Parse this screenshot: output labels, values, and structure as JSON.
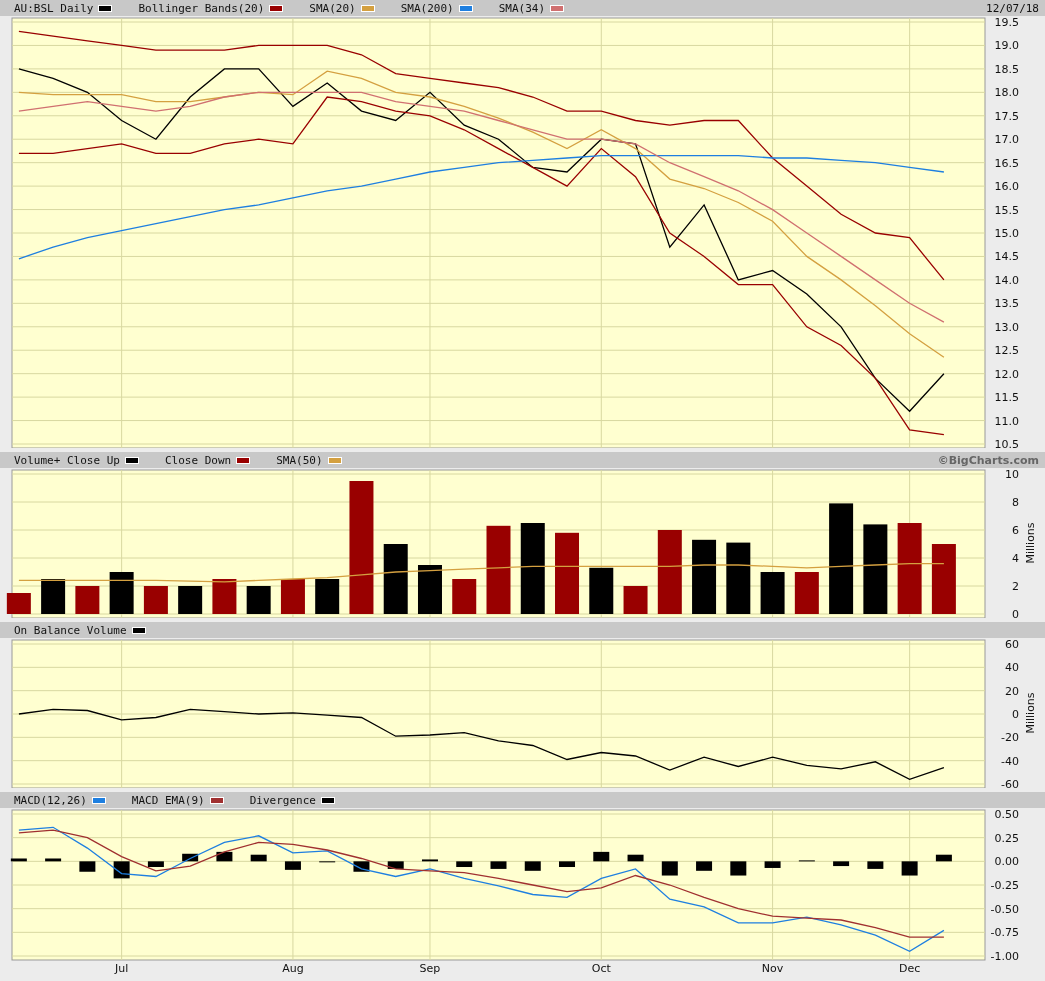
{
  "panels": [
    {
      "right_text": "12/07/18",
      "chart_data": {
        "type": "line",
        "grid": true,
        "categories": [
          null,
          null,
          null,
          null,
          null,
          null,
          null,
          null,
          null,
          null,
          null,
          null,
          null,
          null,
          null,
          null,
          null,
          null,
          null,
          null,
          null,
          null,
          null,
          null,
          null,
          null,
          null,
          null
        ],
        "ylim": [
          10.5,
          19.5
        ],
        "yticks": [
          {
            "value": 10.5,
            "label": "10.5"
          },
          {
            "value": 11,
            "label": "11.0"
          },
          {
            "value": 11.5,
            "label": "11.5"
          },
          {
            "value": 12,
            "label": "12.0"
          },
          {
            "value": 12.5,
            "label": "12.5"
          },
          {
            "value": 13,
            "label": "13.0"
          },
          {
            "value": 13.5,
            "label": "13.5"
          },
          {
            "value": 14,
            "label": "14.0"
          },
          {
            "value": 14.5,
            "label": "14.5"
          },
          {
            "value": 15,
            "label": "15.0"
          },
          {
            "value": 15.5,
            "label": "15.5"
          },
          {
            "value": 16,
            "label": "16.0"
          },
          {
            "value": 16.5,
            "label": "16.5"
          },
          {
            "value": 17,
            "label": "17.0"
          },
          {
            "value": 17.5,
            "label": "17.5"
          },
          {
            "value": 18,
            "label": "18.0"
          },
          {
            "value": 18.5,
            "label": "18.5"
          },
          {
            "value": 19,
            "label": "19.0"
          },
          {
            "value": 19.5,
            "label": "19.5"
          }
        ],
        "series": [
          {
            "name": "AU:BSL Daily",
            "color": "#000000",
            "values": [
              18.5,
              18.3,
              18.0,
              17.4,
              17.0,
              17.9,
              18.5,
              18.5,
              17.7,
              18.2,
              17.6,
              17.4,
              18.0,
              17.3,
              17.0,
              16.4,
              16.3,
              17.0,
              16.9,
              14.7,
              15.6,
              14.0,
              14.2,
              13.7,
              13.0,
              11.9,
              11.2,
              12.0
            ]
          },
          {
            "name": "Bollinger Bands(20)",
            "color": "#990000",
            "values": [
              19.3,
              19.2,
              19.1,
              19.0,
              18.9,
              18.9,
              18.9,
              19.0,
              19.0,
              19.0,
              18.8,
              18.4,
              18.3,
              18.2,
              18.1,
              17.9,
              17.6,
              17.6,
              17.4,
              17.3,
              17.4,
              17.4,
              16.6,
              16.0,
              15.4,
              15.0,
              14.9,
              14.0
            ]
          },
          {
            "color": "#990000",
            "values": [
              16.7,
              16.7,
              16.8,
              16.9,
              16.7,
              16.7,
              16.9,
              17.0,
              16.9,
              17.9,
              17.8,
              17.6,
              17.5,
              17.2,
              16.8,
              16.4,
              16.0,
              16.8,
              16.2,
              15.0,
              14.5,
              13.9,
              13.9,
              13.0,
              12.6,
              11.9,
              10.8,
              10.7
            ]
          },
          {
            "name": "SMA(20)",
            "color": "#d4a040",
            "values": [
              18.0,
              17.95,
              17.95,
              17.95,
              17.8,
              17.8,
              17.9,
              18.0,
              17.95,
              18.45,
              18.3,
              18.0,
              17.9,
              17.7,
              17.45,
              17.15,
              16.8,
              17.2,
              16.8,
              16.15,
              15.95,
              15.65,
              15.25,
              14.5,
              14.0,
              13.45,
              12.85,
              12.35
            ]
          },
          {
            "name": "SMA(200)",
            "color": "#1e7fe0",
            "values": [
              14.45,
              14.7,
              14.9,
              15.05,
              15.2,
              15.35,
              15.5,
              15.6,
              15.75,
              15.9,
              16.0,
              16.15,
              16.3,
              16.4,
              16.5,
              16.55,
              16.6,
              16.65,
              16.65,
              16.65,
              16.65,
              16.65,
              16.6,
              16.6,
              16.55,
              16.5,
              16.4,
              16.3
            ]
          },
          {
            "name": "SMA(34)",
            "color": "#d07070",
            "values": [
              17.6,
              17.7,
              17.8,
              17.7,
              17.6,
              17.7,
              17.9,
              18.0,
              18.0,
              18.0,
              18.0,
              17.8,
              17.7,
              17.6,
              17.4,
              17.2,
              17.0,
              17.0,
              16.9,
              16.5,
              16.2,
              15.9,
              15.5,
              15.0,
              14.5,
              14.0,
              13.5,
              13.1
            ]
          }
        ]
      }
    },
    {
      "right_text": "©BigCharts.com",
      "axis_label": "Millions",
      "chart_data": {
        "type": "bar",
        "grid": true,
        "categories": [
          null,
          null,
          null,
          null,
          null,
          null,
          null,
          null,
          null,
          null,
          null,
          null,
          null,
          null,
          null,
          null,
          null,
          null,
          null,
          null,
          null,
          null,
          null,
          null,
          null,
          null,
          null,
          null
        ],
        "ylim": [
          0,
          10
        ],
        "yticks": [
          {
            "value": 0,
            "label": "0"
          },
          {
            "value": 2,
            "label": "2"
          },
          {
            "value": 4,
            "label": "4"
          },
          {
            "value": 6,
            "label": "6"
          },
          {
            "value": 8,
            "label": "8"
          },
          {
            "value": 10,
            "label": "10"
          }
        ],
        "series": [
          {
            "name": "Volume+ Close Up",
            "type": "bar",
            "color": "#000000",
            "values": [
              null,
              2.5,
              null,
              3,
              null,
              2,
              null,
              2,
              null,
              2.5,
              null,
              5,
              3.5,
              null,
              null,
              6.5,
              null,
              3.3,
              null,
              null,
              5.3,
              5.1,
              3,
              null,
              7.9,
              6.4,
              null,
              null
            ]
          },
          {
            "name": "Close Down",
            "type": "bar",
            "color": "#990000",
            "values": [
              1.5,
              null,
              2,
              null,
              2,
              null,
              2.5,
              null,
              2.5,
              null,
              9.5,
              null,
              null,
              2.5,
              6.3,
              null,
              5.8,
              null,
              2,
              6,
              null,
              null,
              null,
              3,
              null,
              null,
              6.5,
              5
            ]
          },
          {
            "name": "SMA(50)",
            "type": "line",
            "color": "#d4a040",
            "values": [
              2.4,
              2.4,
              2.4,
              2.4,
              2.4,
              2.35,
              2.3,
              2.4,
              2.5,
              2.6,
              2.8,
              3.0,
              3.1,
              3.2,
              3.3,
              3.4,
              3.4,
              3.4,
              3.4,
              3.4,
              3.5,
              3.5,
              3.4,
              3.3,
              3.4,
              3.5,
              3.6,
              3.6
            ]
          }
        ]
      }
    },
    {
      "axis_label": "Millions",
      "chart_data": {
        "type": "line",
        "grid": true,
        "categories": [
          null,
          null,
          null,
          null,
          null,
          null,
          null,
          null,
          null,
          null,
          null,
          null,
          null,
          null,
          null,
          null,
          null,
          null,
          null,
          null,
          null,
          null,
          null,
          null,
          null,
          null,
          null,
          null
        ],
        "ylim": [
          -60,
          60
        ],
        "yticks": [
          {
            "value": -60,
            "label": "-60"
          },
          {
            "value": -40,
            "label": "-40"
          },
          {
            "value": -20,
            "label": "-20"
          },
          {
            "value": 0,
            "label": "0"
          },
          {
            "value": 20,
            "label": "20"
          },
          {
            "value": 40,
            "label": "40"
          },
          {
            "value": 60,
            "label": "60"
          }
        ],
        "series": [
          {
            "name": "On Balance Volume",
            "color": "#000000",
            "values": [
              0,
              4,
              3,
              -5,
              -3,
              4,
              2,
              0,
              1,
              -1,
              -3,
              -19,
              -18,
              -16,
              -23,
              -27,
              -39,
              -33,
              -36,
              -48,
              -37,
              -45,
              -37,
              -44,
              -47,
              -41,
              -56,
              -46
            ]
          }
        ]
      }
    },
    {
      "chart_data": {
        "type": "line",
        "grid": true,
        "categories": [
          null,
          null,
          null,
          "Jul",
          null,
          null,
          null,
          null,
          "Aug",
          null,
          null,
          null,
          "Sep",
          null,
          null,
          null,
          null,
          "Oct",
          null,
          null,
          null,
          null,
          "Nov",
          null,
          null,
          null,
          "Dec",
          null
        ],
        "ylim": [
          -1,
          0.5
        ],
        "yticks": [
          {
            "value": -1,
            "label": "-1.00"
          },
          {
            "value": -0.75,
            "label": "-0.75"
          },
          {
            "value": -0.5,
            "label": "-0.50"
          },
          {
            "value": -0.25,
            "label": "-0.25"
          },
          {
            "value": 0,
            "label": "0.00"
          },
          {
            "value": 0.25,
            "label": "0.25"
          },
          {
            "value": 0.5,
            "label": "0.50"
          }
        ],
        "series": [
          {
            "name": "MACD(12,26)",
            "type": "line",
            "color": "#1e7fe0",
            "values": [
              0.33,
              0.36,
              0.14,
              -0.13,
              -0.16,
              0.03,
              0.2,
              0.27,
              0.09,
              0.11,
              -0.08,
              -0.16,
              -0.08,
              -0.18,
              -0.26,
              -0.35,
              -0.38,
              -0.18,
              -0.08,
              -0.4,
              -0.48,
              -0.65,
              -0.65,
              -0.59,
              -0.67,
              -0.78,
              -0.95,
              -0.73
            ]
          },
          {
            "name": "MACD EMA(9)",
            "type": "line",
            "color": "#a03030",
            "values": [
              0.3,
              0.33,
              0.25,
              0.05,
              -0.1,
              -0.05,
              0.1,
              0.2,
              0.18,
              0.12,
              0.03,
              -0.08,
              -0.1,
              -0.12,
              -0.18,
              -0.25,
              -0.32,
              -0.28,
              -0.15,
              -0.25,
              -0.38,
              -0.5,
              -0.58,
              -0.6,
              -0.62,
              -0.7,
              -0.8,
              -0.8
            ]
          },
          {
            "name": "Divergence",
            "type": "bar",
            "color": "#000000",
            "values": [
              0.03,
              0.03,
              -0.11,
              -0.18,
              -0.06,
              0.08,
              0.1,
              0.07,
              -0.09,
              -0.01,
              -0.11,
              -0.08,
              0.02,
              -0.06,
              -0.08,
              -0.1,
              -0.06,
              0.1,
              0.07,
              -0.15,
              -0.1,
              -0.15,
              -0.07,
              0.01,
              -0.05,
              -0.08,
              -0.15,
              0.07
            ]
          }
        ]
      }
    }
  ]
}
